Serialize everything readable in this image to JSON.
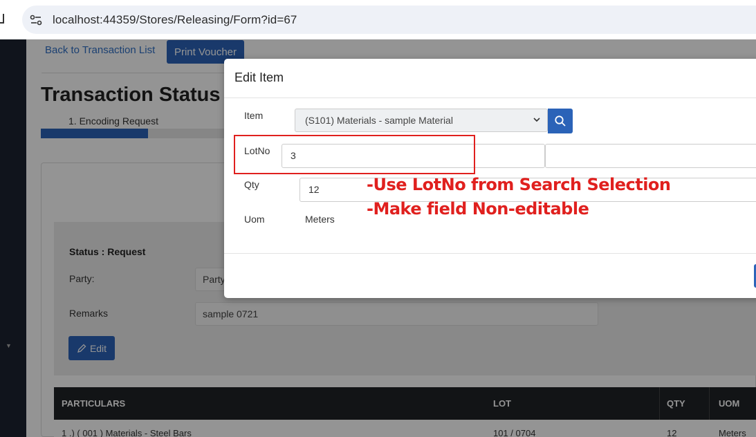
{
  "browser": {
    "url": "localhost:44359/Stores/Releasing/Form?id=67"
  },
  "header": {
    "back_link": "Back to Transaction List",
    "print_button": "Print Voucher"
  },
  "transaction": {
    "title": "Transaction Status :",
    "step_label": "1. Encoding Request",
    "progress_fraction": 0.15
  },
  "status_panel": {
    "status_text": "Status : Request",
    "party_label": "Party:",
    "party_value": "Party",
    "remarks_label": "Remarks",
    "remarks_value": "sample 0721",
    "edit_button": "Edit"
  },
  "table": {
    "headers": [
      "PARTICULARS",
      "LOT",
      "QTY",
      "UOM"
    ],
    "rows": [
      {
        "particulars": "1 .) ( 001 ) Materials - Steel Bars",
        "lot": "101 / 0704",
        "qty": "12",
        "uom": "Meters"
      }
    ]
  },
  "modal": {
    "title": "Edit Item",
    "item_label": "Item",
    "item_selected": "(S101) Materials - sample Material",
    "lotno_label": "LotNo",
    "lotno_value": "3",
    "qty_label": "Qty",
    "qty_value": "12",
    "uom_label": "Uom",
    "uom_value": "Meters"
  },
  "annotations": {
    "line1": "-Use LotNo from Search Selection",
    "line2": "-Make field Non-editable",
    "color": "#e0201e"
  },
  "colors": {
    "primary": "#2b63b8",
    "sidebar": "#1c2331",
    "table_header": "#1f2327"
  }
}
